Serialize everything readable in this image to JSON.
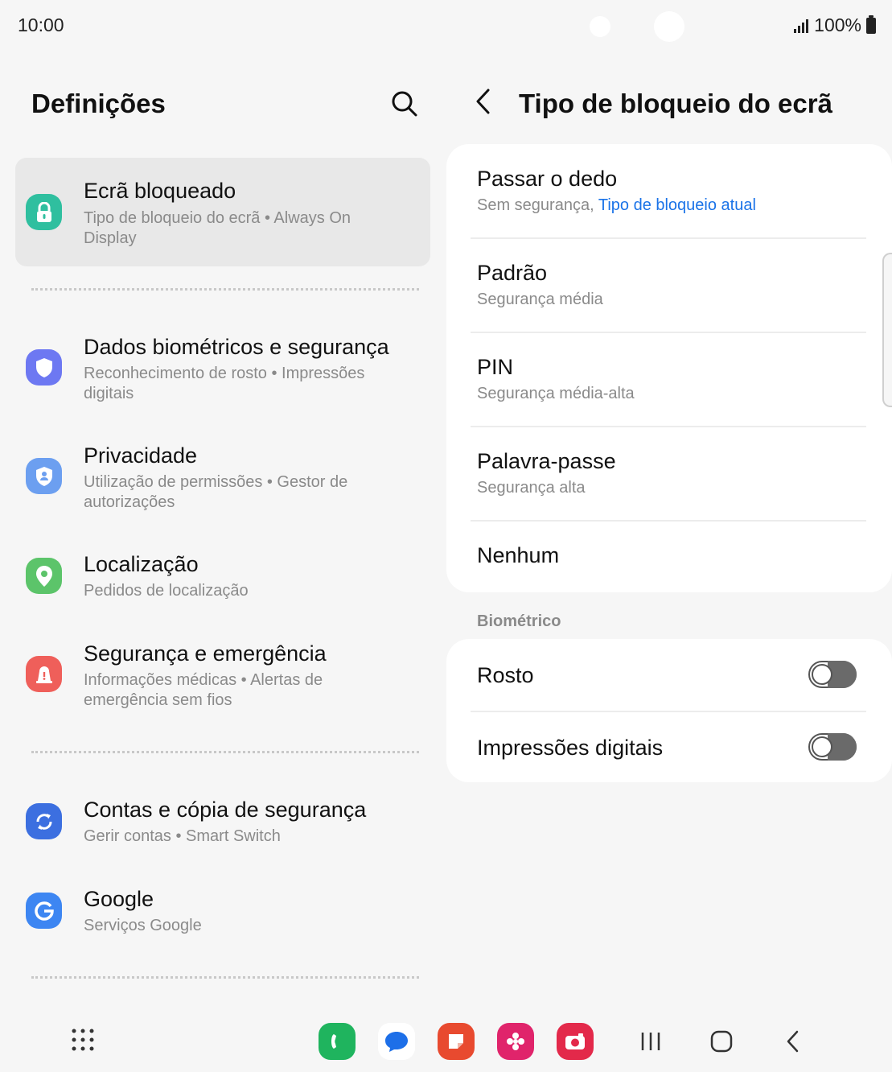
{
  "status": {
    "time": "10:00",
    "battery": "100%"
  },
  "left": {
    "title": "Definições",
    "items": [
      {
        "title": "Ecrã bloqueado",
        "subtitle": "Tipo de bloqueio do ecrã  •  Always On Display"
      },
      {
        "title": "Dados biométricos e segurança",
        "subtitle": "Reconhecimento de rosto  •  Impressões digitais"
      },
      {
        "title": "Privacidade",
        "subtitle": "Utilização de permissões  •  Gestor de autorizações"
      },
      {
        "title": "Localização",
        "subtitle": "Pedidos de localização"
      },
      {
        "title": "Segurança e emergência",
        "subtitle": "Informações médicas  •  Alertas de emergência sem fios"
      },
      {
        "title": "Contas e cópia de segurança",
        "subtitle": "Gerir contas  •  Smart Switch"
      },
      {
        "title": "Google",
        "subtitle": "Serviços Google"
      }
    ]
  },
  "right": {
    "title": "Tipo de bloqueio do ecrã",
    "options": [
      {
        "title": "Passar o dedo",
        "subtitle": "Sem segurança,",
        "current": "Tipo de bloqueio atual"
      },
      {
        "title": "Padrão",
        "subtitle": "Segurança média"
      },
      {
        "title": "PIN",
        "subtitle": "Segurança média-alta"
      },
      {
        "title": "Palavra-passe",
        "subtitle": "Segurança alta"
      },
      {
        "title": "Nenhum"
      }
    ],
    "biometric_label": "Biométrico",
    "biometrics": [
      {
        "title": "Rosto",
        "enabled": false
      },
      {
        "title": "Impressões digitais",
        "enabled": false
      }
    ]
  },
  "colors": {
    "lock": "#2fbf9f",
    "shield": "#6d78f2",
    "privacy": "#6c9ff0",
    "location": "#5cc46a",
    "emergency": "#ef5f5a",
    "accounts": "#3c6fe0",
    "google": "#3d86f2",
    "link": "#1a73e8"
  },
  "dock_apps": [
    "phone-app",
    "messages-app",
    "notes-app",
    "gallery-app",
    "camera-app"
  ]
}
